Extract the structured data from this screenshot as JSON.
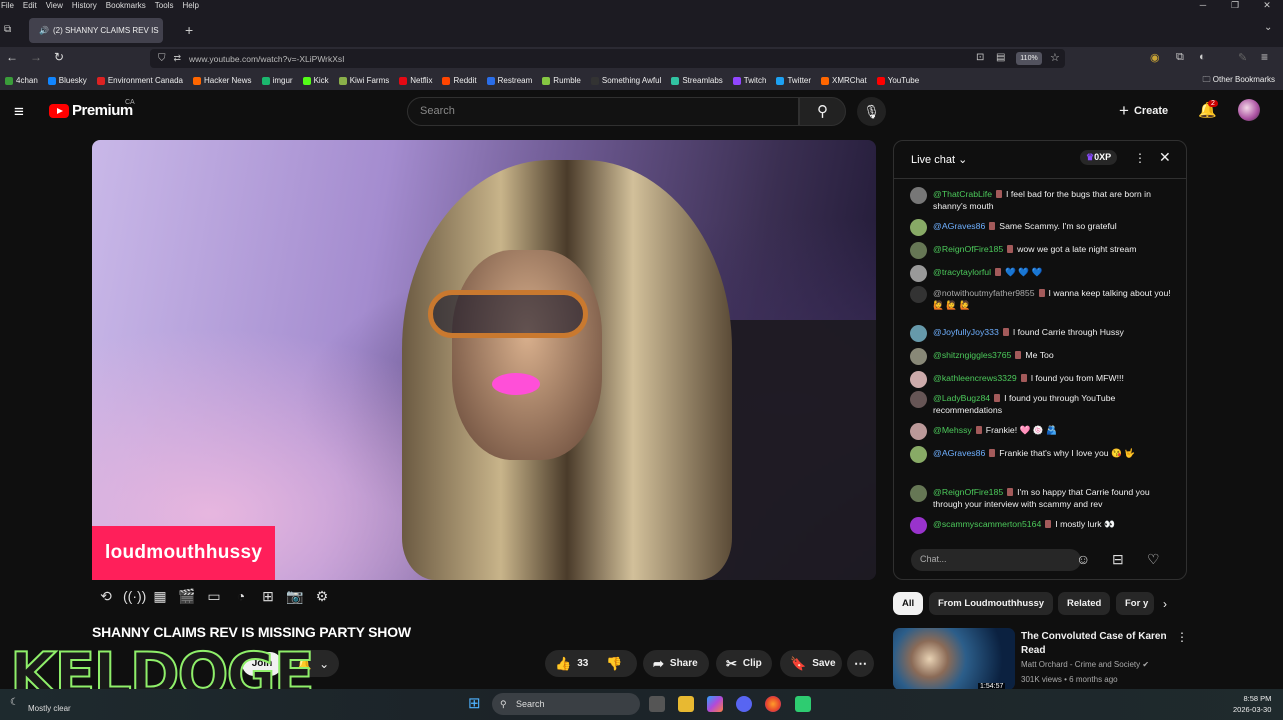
{
  "menubar": {
    "items": [
      "File",
      "Edit",
      "View",
      "History",
      "Bookmarks",
      "Tools",
      "Help"
    ]
  },
  "tab": {
    "title": "(2) SHANNY CLAIMS REV IS"
  },
  "url": "www.youtube.com/watch?v=-XLiPWrkXsI",
  "zoom": "110%",
  "bookmarks": [
    {
      "label": "4chan",
      "color": "#3a9c3a"
    },
    {
      "label": "Bluesky",
      "color": "#1185fe"
    },
    {
      "label": "Environment Canada",
      "color": "#d22"
    },
    {
      "label": "Hacker News",
      "color": "#ff6600"
    },
    {
      "label": "imgur",
      "color": "#1bb76e"
    },
    {
      "label": "Kick",
      "color": "#53fc18"
    },
    {
      "label": "Kiwi Farms",
      "color": "#8ab04a"
    },
    {
      "label": "Netflix",
      "color": "#e50914"
    },
    {
      "label": "Reddit",
      "color": "#ff4500"
    },
    {
      "label": "Restream",
      "color": "#2a6de8"
    },
    {
      "label": "Rumble",
      "color": "#85c742"
    },
    {
      "label": "Something Awful",
      "color": "#333"
    },
    {
      "label": "Streamlabs",
      "color": "#31c3a2"
    },
    {
      "label": "Twitch",
      "color": "#9146ff"
    },
    {
      "label": "Twitter",
      "color": "#1da1f2"
    },
    {
      "label": "XMRChat",
      "color": "#f60"
    },
    {
      "label": "YouTube",
      "color": "#f00"
    }
  ],
  "other_bookmarks": "Other Bookmarks",
  "header": {
    "logo": "Premium",
    "region": "CA",
    "search_placeholder": "Search",
    "create": "Create",
    "notif_count": "2"
  },
  "video": {
    "overlay_name": "loudmouthhussy",
    "title": "SHANNY CLAIMS REV IS MISSING PARTY SHOW"
  },
  "watermark": "KELDOGE",
  "actions": {
    "join": "Join",
    "likes": "33",
    "share": "Share",
    "clip": "Clip",
    "save": "Save"
  },
  "chat": {
    "title": "Live chat",
    "xp": "0XP",
    "input_placeholder": "Chat...",
    "messages": [
      {
        "user": "@ThatCrabLife",
        "text": "I feel bad for the bugs that are born in shanny's mouth",
        "cls": "g",
        "av": "#777"
      },
      {
        "user": "@AGraves86",
        "text": "Same Scammy. I'm so grateful",
        "cls": "",
        "av": "#8a6"
      },
      {
        "user": "@ReignOfFire185",
        "text": "wow we got a late night stream",
        "cls": "g",
        "av": "#675"
      },
      {
        "user": "@tracytaylorful",
        "text": "💙 💙 💙",
        "cls": "g",
        "av": "#999"
      },
      {
        "user": "@notwithoutmyfather9855",
        "text": "I wanna keep talking about you! 🙋 🙋 🙋",
        "cls": "w",
        "av": "#333"
      },
      {
        "user": "@JoyfullyJoy333",
        "text": "I found Carrie through Hussy",
        "cls": "",
        "av": "#69a"
      },
      {
        "user": "@shitzngiggles3765",
        "text": "Me Too",
        "cls": "g",
        "av": "#887"
      },
      {
        "user": "@kathleencrews3329",
        "text": "I found you from MFW!!!",
        "cls": "g",
        "av": "#caa"
      },
      {
        "user": "@LadyBugz84",
        "text": "I found you through YouTube recommendations",
        "cls": "g",
        "av": "#655"
      },
      {
        "user": "@Mehssy",
        "text": "Frankie! 🩷 🍥 🫂",
        "cls": "g",
        "av": "#b99"
      },
      {
        "user": "@AGraves86",
        "text": "Frankie that's why I love you 😘 🤟",
        "cls": "",
        "av": "#8a6"
      },
      {
        "user": "@ReignOfFire185",
        "text": "I'm so happy that Carrie found you through your interview with scammy and rev",
        "cls": "g",
        "av": "#675"
      },
      {
        "user": "@scammyscammerton5164",
        "text": "I mostly lurk 👀",
        "cls": "g",
        "av": "#93c"
      }
    ]
  },
  "chips": [
    "All",
    "From Loudmouthhussy",
    "Related",
    "For y"
  ],
  "related": {
    "title": "The Convoluted Case of Karen Read",
    "channel": "Matt Orchard - Crime and Society",
    "meta": "301K views • 6 months ago",
    "duration": "1:54:57"
  },
  "taskbar": {
    "weather": "Mostly clear",
    "search": "Search",
    "time": "8:58 PM",
    "date": "2026-03-30"
  }
}
